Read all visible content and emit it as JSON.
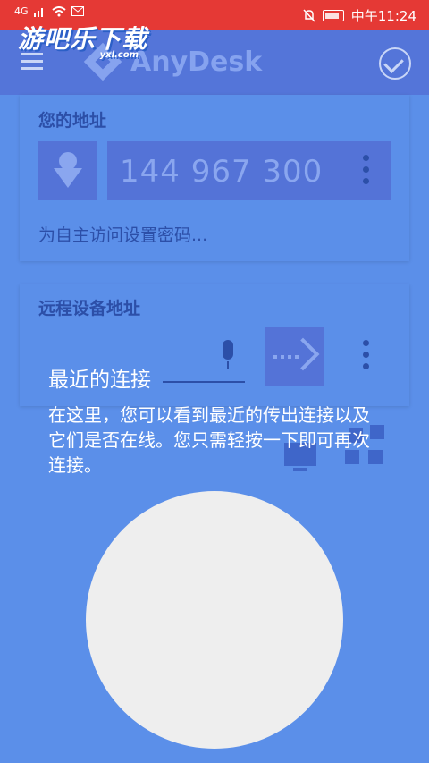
{
  "status_bar": {
    "network": "4G",
    "time": "中午11:24"
  },
  "watermark": {
    "text": "游吧乐下载",
    "sub": "yxl.com"
  },
  "app_bar": {
    "logo_text": "AnyDesk"
  },
  "address_card": {
    "title": "您的地址",
    "address": "144 967 300",
    "set_password_link": "为自主访问设置密码..."
  },
  "remote_card": {
    "title": "远程设备地址"
  },
  "tip": {
    "title": "最近的连接",
    "body": "在这里，您可以看到最近的传出连接以及它们是否在线。您只需轻按一下即可再次连接。"
  },
  "colors": {
    "overlay": "#5b8fe9",
    "status_bar": "#e53935",
    "spotlight": "#eeeeee"
  }
}
